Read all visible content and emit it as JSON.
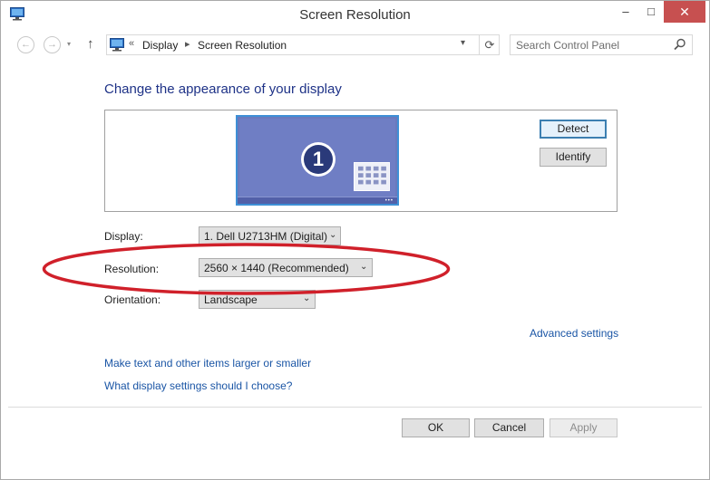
{
  "window": {
    "title": "Screen Resolution",
    "controls": {
      "minimize": "–",
      "maximize": "□",
      "close": "✕"
    }
  },
  "navigation": {
    "back_glyph": "←",
    "forward_glyph": "→",
    "history_glyph": "▾",
    "up_glyph": "↑",
    "breadcrumb_prefix": "«",
    "breadcrumbs": [
      "Display",
      "Screen Resolution"
    ],
    "breadcrumb_separator": "▸",
    "dropdown_glyph": "▾",
    "refresh_glyph": "⟳",
    "search_placeholder": "Search Control Panel"
  },
  "main": {
    "heading": "Change the appearance of your display",
    "monitor_number": "1",
    "monitor_dots": "•••",
    "detect_label": "Detect",
    "identify_label": "Identify",
    "display": {
      "label": "Display:",
      "value": "1. Dell U2713HM (Digital)"
    },
    "resolution": {
      "label": "Resolution:",
      "value": "2560 × 1440 (Recommended)"
    },
    "orientation": {
      "label": "Orientation:",
      "value": "Landscape"
    },
    "select_arrow": "⌄",
    "advanced_link": "Advanced settings",
    "link_larger": "Make text and other items larger or smaller",
    "link_which": "What display settings should I choose?"
  },
  "footer": {
    "ok_label": "OK",
    "cancel_label": "Cancel",
    "apply_label": "Apply"
  },
  "colors": {
    "heading": "#1e3287",
    "link": "#1a55a5",
    "monitor": "#6a79bc",
    "monitor_border": "#3e8fd6",
    "annotation_ellipse": "#d0202a",
    "close_button": "#c75050"
  },
  "icons": {
    "app": "display-settings-icon",
    "search": "magnifier-icon"
  }
}
